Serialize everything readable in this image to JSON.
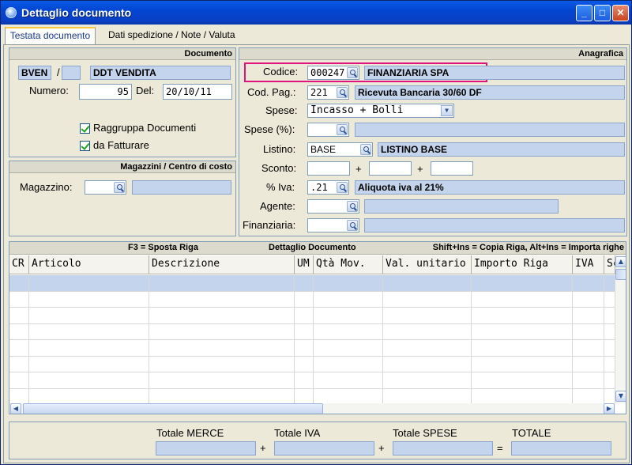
{
  "window": {
    "title": "Dettaglio documento"
  },
  "tabs": [
    {
      "label": "Testata documento"
    },
    {
      "label": "Dati spedizione / Note / Valuta"
    }
  ],
  "documento": {
    "header": "Documento",
    "serie": "BVEN",
    "separator": "/",
    "numero_serie": "",
    "tipo": "DDT VENDITA",
    "numero_label": "Numero:",
    "numero": "95",
    "del_label": "Del:",
    "data": "20/10/11",
    "raggruppa_label": "Raggruppa Documenti",
    "fatturare_label": "da Fatturare"
  },
  "magazzini": {
    "header": "Magazzini / Centro di costo",
    "magazzino_label": "Magazzino:",
    "magazzino": "",
    "magazzino_desc": ""
  },
  "anagrafica": {
    "header": "Anagrafica",
    "codice_label": "Codice:",
    "codice": "000247",
    "codice_desc": "FINANZIARIA SPA",
    "codpag_label": "Cod. Pag.:",
    "codpag": "221",
    "codpag_desc": "Ricevuta Bancaria 30/60 DF",
    "spese_label": "Spese:",
    "spese": "Incasso + Bolli",
    "spesepct_label": "Spese (%):",
    "listino_label": "Listino:",
    "listino": "BASE",
    "listino_desc": "LISTINO BASE",
    "sconto_label": "Sconto:",
    "plus": "+",
    "iva_label": "% Iva:",
    "iva": ".21",
    "iva_desc": "Aliquota iva al 21%",
    "agente_label": "Agente:",
    "finanziaria_label": "Finanziaria:"
  },
  "grid": {
    "hint_left": "F3 = Sposta Riga",
    "title": "Dettaglio Documento",
    "hint_right": "Shift+Ins = Copia Riga, Alt+Ins = Importa righe",
    "columns": [
      "CR",
      "Articolo",
      "Descrizione",
      "UM",
      "Qtà Mov.",
      "Val. unitario",
      "Importo Riga",
      "IVA",
      "Sc"
    ]
  },
  "totals": {
    "merce_label": "Totale MERCE",
    "iva_label": "Totale IVA",
    "spese_label": "Totale SPESE",
    "totale_label": "TOTALE",
    "plus": "+",
    "equals": "="
  },
  "colors": {
    "highlight": "#e0147c",
    "title_bar": "#0a5ae6",
    "field_blue": "#c4d4ec"
  }
}
